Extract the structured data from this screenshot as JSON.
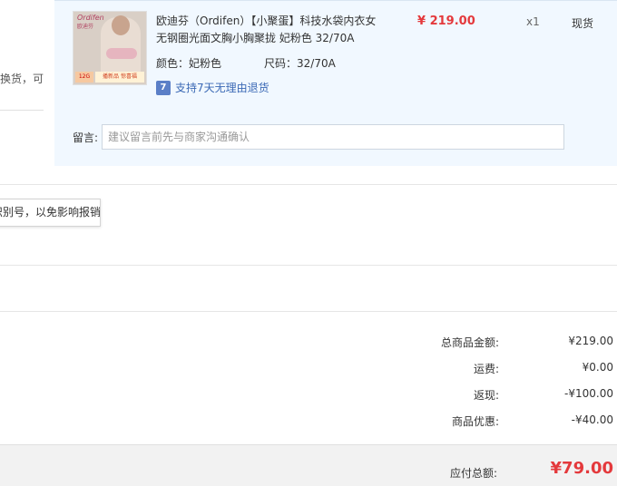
{
  "left_panel": {
    "clipped_text": "换货，可"
  },
  "item": {
    "thumbnail": {
      "brand_text": "Ordifen",
      "brand_sub": "欧迪芬",
      "badge_left": "12G",
      "badge_right": "播新品 惊喜福"
    },
    "title": "欧迪芬（Ordifen）【小聚蛋】科技水袋内衣女无钢圈光面文胸小胸聚拢 妃粉色 32/70A",
    "color_label": "颜色：",
    "color_value": "妃粉色",
    "size_label": "尺码：",
    "size_value": "32/70A",
    "price": "¥ 219.00",
    "quantity": "x1",
    "stock_status": "现货",
    "return_badge": "7",
    "return_text": "支持7天无理由退货",
    "remark_label": "留言:",
    "remark_placeholder": "建议留言前先与商家沟通确认"
  },
  "tooltip": {
    "text": "识别号，以免影响报销"
  },
  "summary": [
    {
      "label": "总商品金额:",
      "value": "¥219.00"
    },
    {
      "label": "运费:",
      "value": "¥0.00"
    },
    {
      "label": "返现:",
      "value": "-¥100.00"
    },
    {
      "label": "商品优惠:",
      "value": "-¥40.00"
    }
  ],
  "total": {
    "label": "应付总额:",
    "value": "¥79.00"
  },
  "colors": {
    "price_red": "#e4393c",
    "panel_bg": "#f1f8ff",
    "link_blue": "#3b69b5"
  }
}
